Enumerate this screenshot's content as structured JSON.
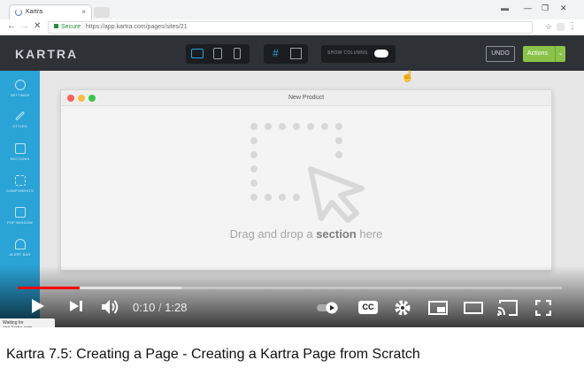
{
  "browser": {
    "tab_title": "Kartra",
    "tab_close": "×",
    "url_secure": "Secure",
    "url": "https://app.kartra.com/pages/sites/21",
    "window_controls": [
      "▬",
      "—",
      "❐",
      "✕"
    ]
  },
  "kartra": {
    "logo": "KARTRA",
    "show_columns": "SHOW COLUMNS",
    "undo": "UNDO",
    "actions": "Actions",
    "sidebar": [
      {
        "label": "SETTINGS",
        "icon": "gear-icon"
      },
      {
        "label": "STYLES",
        "icon": "brush-icon"
      },
      {
        "label": "SECTIONS",
        "icon": "grid-icon"
      },
      {
        "label": "COMPONENTS",
        "icon": "crop-icon"
      },
      {
        "label": "POP WINDOW",
        "icon": "popup-icon"
      },
      {
        "label": "ALERT BAR",
        "icon": "bell-icon"
      }
    ],
    "window_title": "New Product",
    "drop_hint_pre": "Drag and drop a",
    "drop_hint_bold": "section",
    "drop_hint_post": "here"
  },
  "player": {
    "current_time": "0:10",
    "duration": "1:28",
    "progress_fraction": 0.114,
    "loaded_fraction": 0.3,
    "cc": "CC",
    "status_text": "Waiting for app.kartra.com..."
  },
  "video_title": "Kartra 7.5: Creating a Page - Creating a Kartra Page from Scratch",
  "colors": {
    "accent": "#2aa3d6",
    "actions": "#8bc34a",
    "progress": "#ff0000"
  }
}
